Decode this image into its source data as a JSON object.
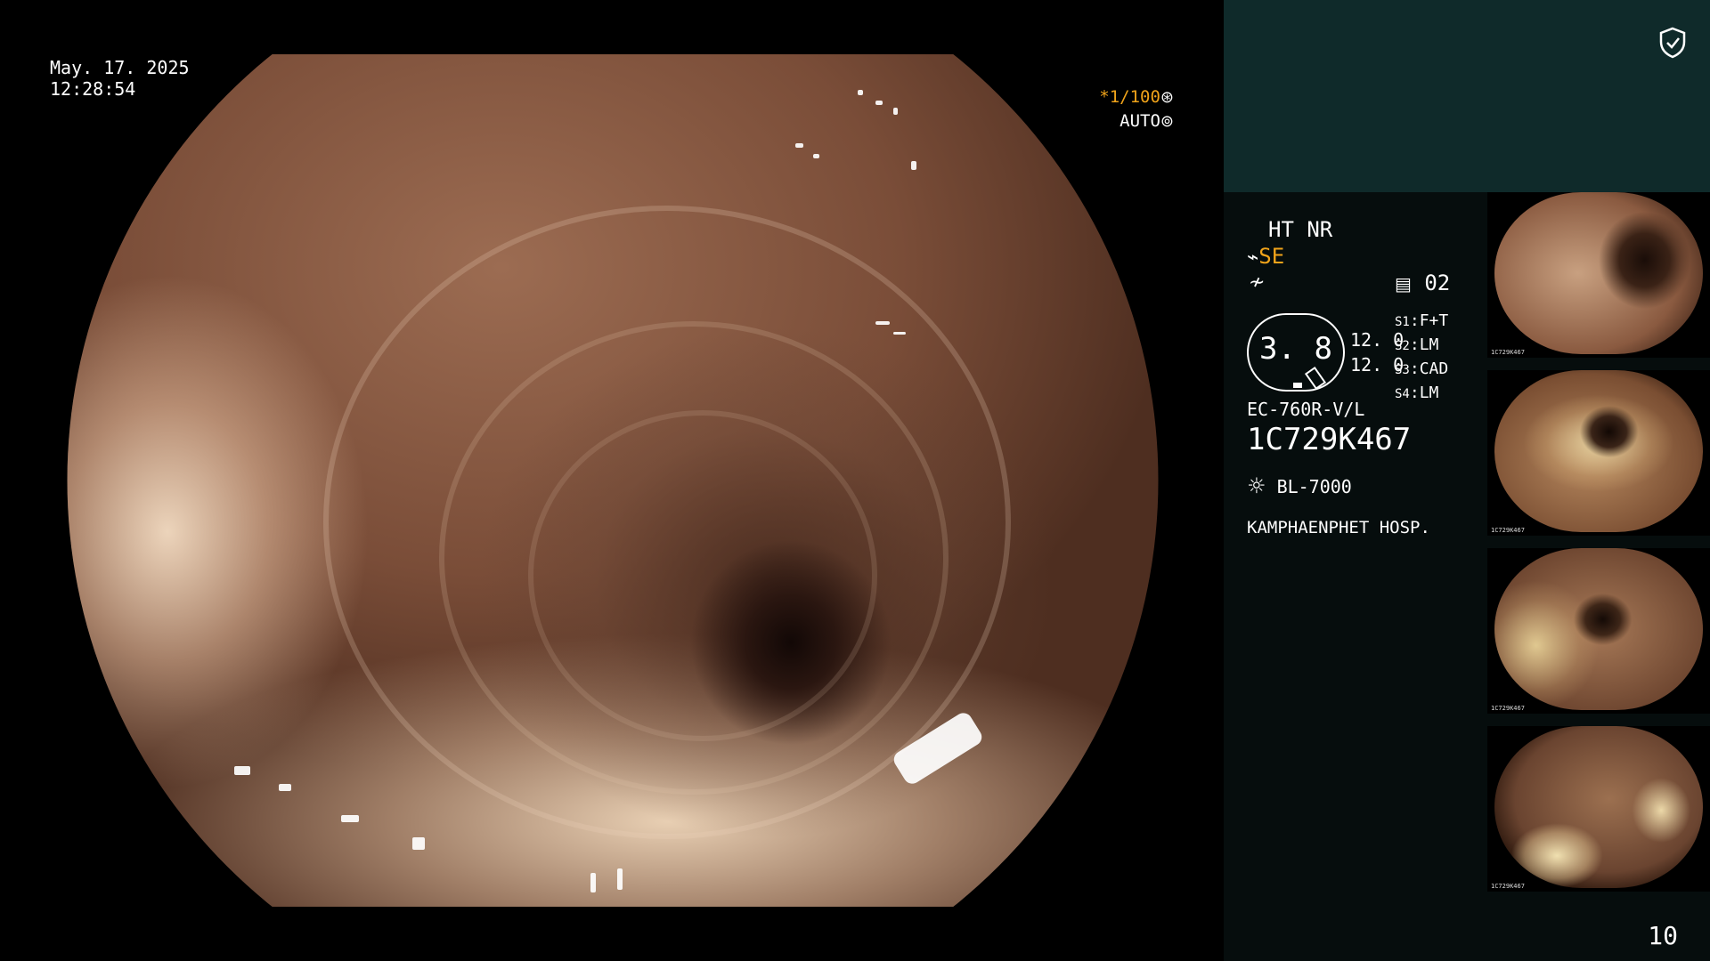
{
  "overlay": {
    "date": "May. 17. 2025",
    "time": "12:28:54",
    "shutter": "*1/100",
    "iris": "AUTO",
    "shutter_icon": "aperture-icon",
    "iris_icon": "iris-icon"
  },
  "panel": {
    "mode_line": "HT NR",
    "enhance": "SE",
    "enhance_icon": "structure-enhance-icon",
    "color_icon": "color-mode-icon",
    "channel_icon": "channel-icon",
    "channel": "02",
    "ring_value": "3. 8",
    "levels": [
      "12. 0",
      "12. 0"
    ],
    "switches": [
      {
        "key": "S1",
        "value": "F+T"
      },
      {
        "key": "S2",
        "value": "LM"
      },
      {
        "key": "S3",
        "value": "CAD"
      },
      {
        "key": "S4",
        "value": "LM"
      }
    ],
    "scope_model": "EC-760R-V/L",
    "serial": "1C729K467",
    "light_source": "BL-7000",
    "light_icon": "sun-icon",
    "hospital": "KAMPHAENPHET HOSP.",
    "counter": "10",
    "shield_icon": "shield-check-icon"
  },
  "thumbnails": [
    {
      "caption": "1C729K467"
    },
    {
      "caption": "1C729K467"
    },
    {
      "caption": "1C729K467"
    },
    {
      "caption": "1C729K467"
    }
  ],
  "colors": {
    "accent": "#f0a31a",
    "panel_top": "#0f2a2a",
    "panel_bg": "#060d0d"
  }
}
